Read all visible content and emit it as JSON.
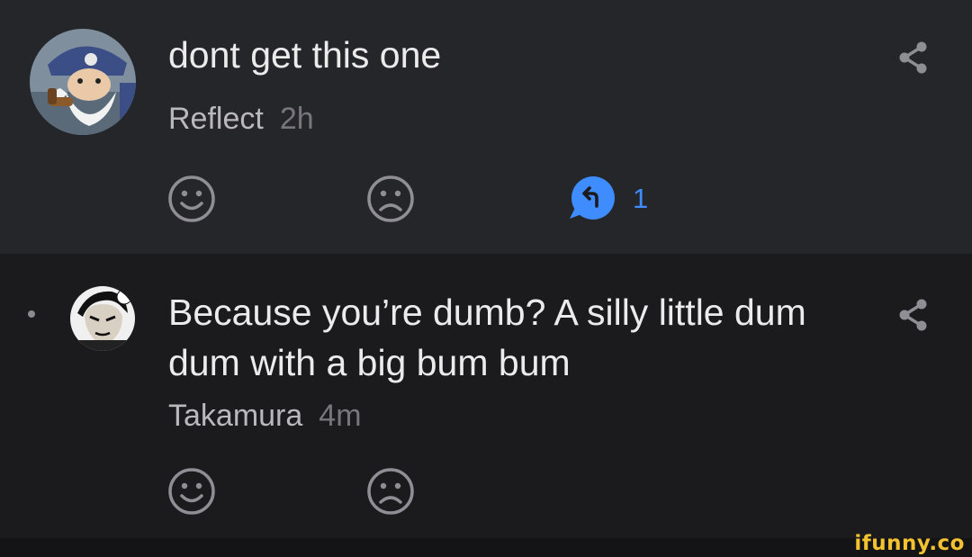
{
  "comments": [
    {
      "text": "dont get this one",
      "author": "Reflect",
      "time": "2h",
      "reply_count": "1",
      "avatar_icon": "old-sailor-with-pipe-avatar",
      "accent": "#3f8cff"
    },
    {
      "text": "Because you’re dumb? A silly little dum dum with a big bum bum",
      "author": "Takamura",
      "time": "4m",
      "avatar_icon": "manga-character-avatar"
    }
  ],
  "icons": {
    "smile": "smiley-face-icon",
    "frown": "frowny-face-icon",
    "reply": "reply-bubble-icon",
    "share": "share-icon"
  },
  "watermark": "ifunny.co"
}
